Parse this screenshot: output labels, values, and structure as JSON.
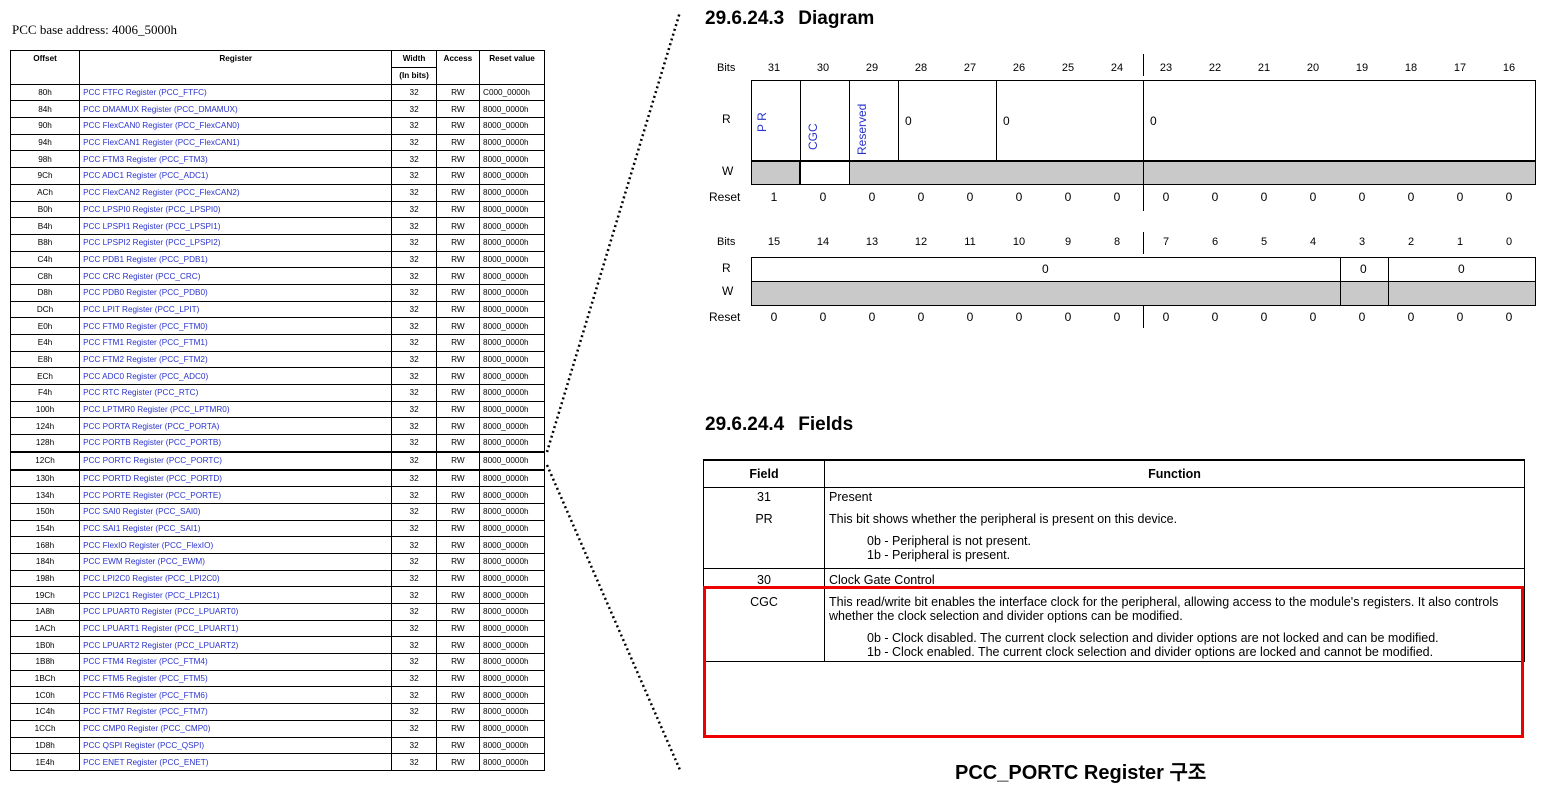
{
  "left": {
    "title": "PCC base address: 4006_5000h",
    "headers": {
      "offset": "Offset",
      "register": "Register",
      "width": "Width",
      "width_sub": "(In bits)",
      "access": "Access",
      "reset": "Reset value"
    },
    "rows": [
      {
        "off": "80h",
        "reg": "PCC FTFC Register (PCC_FTFC)",
        "w": "32",
        "acc": "RW",
        "rst": "C000_0000h"
      },
      {
        "off": "84h",
        "reg": "PCC DMAMUX Register (PCC_DMAMUX)",
        "w": "32",
        "acc": "RW",
        "rst": "8000_0000h"
      },
      {
        "off": "90h",
        "reg": "PCC FlexCAN0 Register (PCC_FlexCAN0)",
        "w": "32",
        "acc": "RW",
        "rst": "8000_0000h"
      },
      {
        "off": "94h",
        "reg": "PCC FlexCAN1 Register (PCC_FlexCAN1)",
        "w": "32",
        "acc": "RW",
        "rst": "8000_0000h"
      },
      {
        "off": "98h",
        "reg": "PCC FTM3 Register (PCC_FTM3)",
        "w": "32",
        "acc": "RW",
        "rst": "8000_0000h"
      },
      {
        "off": "9Ch",
        "reg": "PCC ADC1 Register (PCC_ADC1)",
        "w": "32",
        "acc": "RW",
        "rst": "8000_0000h"
      },
      {
        "off": "ACh",
        "reg": "PCC FlexCAN2 Register (PCC_FlexCAN2)",
        "w": "32",
        "acc": "RW",
        "rst": "8000_0000h"
      },
      {
        "off": "B0h",
        "reg": "PCC LPSPI0 Register (PCC_LPSPI0)",
        "w": "32",
        "acc": "RW",
        "rst": "8000_0000h"
      },
      {
        "off": "B4h",
        "reg": "PCC LPSPI1 Register (PCC_LPSPI1)",
        "w": "32",
        "acc": "RW",
        "rst": "8000_0000h"
      },
      {
        "off": "B8h",
        "reg": "PCC LPSPI2 Register (PCC_LPSPI2)",
        "w": "32",
        "acc": "RW",
        "rst": "8000_0000h"
      },
      {
        "off": "C4h",
        "reg": "PCC PDB1 Register (PCC_PDB1)",
        "w": "32",
        "acc": "RW",
        "rst": "8000_0000h"
      },
      {
        "off": "C8h",
        "reg": "PCC CRC Register (PCC_CRC)",
        "w": "32",
        "acc": "RW",
        "rst": "8000_0000h"
      },
      {
        "off": "D8h",
        "reg": "PCC PDB0 Register (PCC_PDB0)",
        "w": "32",
        "acc": "RW",
        "rst": "8000_0000h"
      },
      {
        "off": "DCh",
        "reg": "PCC LPIT Register (PCC_LPIT)",
        "w": "32",
        "acc": "RW",
        "rst": "8000_0000h"
      },
      {
        "off": "E0h",
        "reg": "PCC FTM0 Register (PCC_FTM0)",
        "w": "32",
        "acc": "RW",
        "rst": "8000_0000h"
      },
      {
        "off": "E4h",
        "reg": "PCC FTM1 Register (PCC_FTM1)",
        "w": "32",
        "acc": "RW",
        "rst": "8000_0000h"
      },
      {
        "off": "E8h",
        "reg": "PCC FTM2 Register (PCC_FTM2)",
        "w": "32",
        "acc": "RW",
        "rst": "8000_0000h"
      },
      {
        "off": "ECh",
        "reg": "PCC ADC0 Register (PCC_ADC0)",
        "w": "32",
        "acc": "RW",
        "rst": "8000_0000h"
      },
      {
        "off": "F4h",
        "reg": "PCC RTC Register (PCC_RTC)",
        "w": "32",
        "acc": "RW",
        "rst": "8000_0000h"
      },
      {
        "off": "100h",
        "reg": "PCC LPTMR0 Register (PCC_LPTMR0)",
        "w": "32",
        "acc": "RW",
        "rst": "8000_0000h"
      },
      {
        "off": "124h",
        "reg": "PCC PORTA Register (PCC_PORTA)",
        "w": "32",
        "acc": "RW",
        "rst": "8000_0000h"
      },
      {
        "off": "128h",
        "reg": "PCC PORTB Register (PCC_PORTB)",
        "w": "32",
        "acc": "RW",
        "rst": "8000_0000h"
      },
      {
        "off": "12Ch",
        "reg": "PCC PORTC Register (PCC_PORTC)",
        "w": "32",
        "acc": "RW",
        "rst": "8000_0000h"
      },
      {
        "off": "130h",
        "reg": "PCC PORTD Register (PCC_PORTD)",
        "w": "32",
        "acc": "RW",
        "rst": "8000_0000h"
      },
      {
        "off": "134h",
        "reg": "PCC PORTE Register (PCC_PORTE)",
        "w": "32",
        "acc": "RW",
        "rst": "8000_0000h"
      },
      {
        "off": "150h",
        "reg": "PCC SAI0 Register (PCC_SAI0)",
        "w": "32",
        "acc": "RW",
        "rst": "8000_0000h"
      },
      {
        "off": "154h",
        "reg": "PCC SAI1 Register (PCC_SAI1)",
        "w": "32",
        "acc": "RW",
        "rst": "8000_0000h"
      },
      {
        "off": "168h",
        "reg": "PCC FlexIO Register (PCC_FlexIO)",
        "w": "32",
        "acc": "RW",
        "rst": "8000_0000h"
      },
      {
        "off": "184h",
        "reg": "PCC EWM Register (PCC_EWM)",
        "w": "32",
        "acc": "RW",
        "rst": "8000_0000h"
      },
      {
        "off": "198h",
        "reg": "PCC LPI2C0 Register (PCC_LPI2C0)",
        "w": "32",
        "acc": "RW",
        "rst": "8000_0000h"
      },
      {
        "off": "19Ch",
        "reg": "PCC LPI2C1 Register (PCC_LPI2C1)",
        "w": "32",
        "acc": "RW",
        "rst": "8000_0000h"
      },
      {
        "off": "1A8h",
        "reg": "PCC LPUART0 Register (PCC_LPUART0)",
        "w": "32",
        "acc": "RW",
        "rst": "8000_0000h"
      },
      {
        "off": "1ACh",
        "reg": "PCC LPUART1 Register (PCC_LPUART1)",
        "w": "32",
        "acc": "RW",
        "rst": "8000_0000h"
      },
      {
        "off": "1B0h",
        "reg": "PCC LPUART2 Register (PCC_LPUART2)",
        "w": "32",
        "acc": "RW",
        "rst": "8000_0000h"
      },
      {
        "off": "1B8h",
        "reg": "PCC FTM4 Register (PCC_FTM4)",
        "w": "32",
        "acc": "RW",
        "rst": "8000_0000h"
      },
      {
        "off": "1BCh",
        "reg": "PCC FTM5 Register (PCC_FTM5)",
        "w": "32",
        "acc": "RW",
        "rst": "8000_0000h"
      },
      {
        "off": "1C0h",
        "reg": "PCC FTM6 Register (PCC_FTM6)",
        "w": "32",
        "acc": "RW",
        "rst": "8000_0000h"
      },
      {
        "off": "1C4h",
        "reg": "PCC FTM7 Register (PCC_FTM7)",
        "w": "32",
        "acc": "RW",
        "rst": "8000_0000h"
      },
      {
        "off": "1CCh",
        "reg": "PCC CMP0 Register (PCC_CMP0)",
        "w": "32",
        "acc": "RW",
        "rst": "8000_0000h"
      },
      {
        "off": "1D8h",
        "reg": "PCC QSPI Register (PCC_QSPI)",
        "w": "32",
        "acc": "RW",
        "rst": "8000_0000h"
      },
      {
        "off": "1E4h",
        "reg": "PCC ENET Register (PCC_ENET)",
        "w": "32",
        "acc": "RW",
        "rst": "8000_0000h"
      }
    ],
    "highlighted_offset": "12Ch"
  },
  "diagram": {
    "section_num": "29.6.24.3",
    "section_title": "Diagram",
    "labels": {
      "bits": "Bits",
      "r": "R",
      "w": "W",
      "reset": "Reset"
    },
    "upper_bits": [
      "31",
      "30",
      "29",
      "28",
      "27",
      "26",
      "25",
      "24",
      "23",
      "22",
      "21",
      "20",
      "19",
      "18",
      "17",
      "16"
    ],
    "upper_reset": [
      "1",
      "0",
      "0",
      "0",
      "0",
      "0",
      "0",
      "0",
      "0",
      "0",
      "0",
      "0",
      "0",
      "0",
      "0",
      "0"
    ],
    "lower_bits": [
      "15",
      "14",
      "13",
      "12",
      "11",
      "10",
      "9",
      "8",
      "7",
      "6",
      "5",
      "4",
      "3",
      "2",
      "1",
      "0"
    ],
    "lower_reset": [
      "0",
      "0",
      "0",
      "0",
      "0",
      "0",
      "0",
      "0",
      "0",
      "0",
      "0",
      "0",
      "0",
      "0",
      "0",
      "0"
    ],
    "field_pr": "P R",
    "field_cgc": "CGC",
    "field_reserved": "Reserved",
    "zero": "0"
  },
  "fields": {
    "section_num": "29.6.24.4",
    "section_title": "Fields",
    "col_field": "Field",
    "col_function": "Function",
    "pr": {
      "bit": "31",
      "name": "PR",
      "title": "Present",
      "desc": "This bit shows whether the peripheral is present on this device.",
      "opt0": "0b - Peripheral is not present.",
      "opt1": "1b - Peripheral is present."
    },
    "cgc": {
      "bit": "30",
      "name": "CGC",
      "title": "Clock Gate Control",
      "desc": "This read/write bit enables the interface clock for the peripheral, allowing access to the module's registers. It also controls whether the clock selection and divider options can be modified.",
      "opt0": "0b - Clock disabled. The current clock selection and divider options are not locked and can be modified.",
      "opt1": "1b - Clock enabled. The current clock selection and divider options are locked and cannot be modified."
    }
  },
  "caption": "PCC_PORTC Register 구조",
  "colors": {
    "link_blue": "#2a33cc",
    "highlight_red": "#e00000",
    "grey_fill": "#c9c9c9"
  }
}
